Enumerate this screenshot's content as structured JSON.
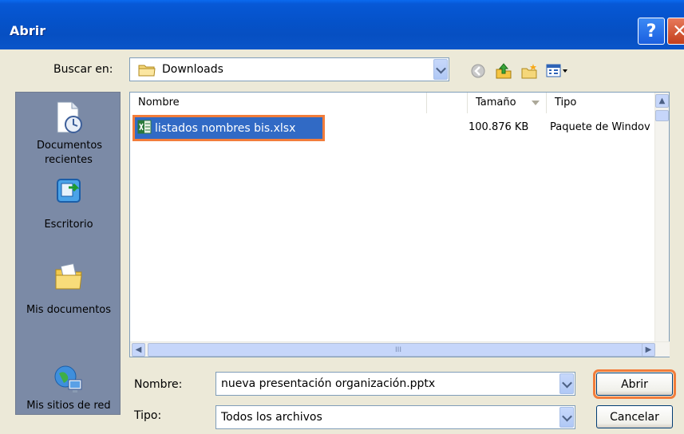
{
  "window": {
    "title": "Abrir",
    "help_label": "?",
    "close_label": "✕"
  },
  "location": {
    "label": "Buscar en:",
    "value": "Downloads"
  },
  "toolbar": {
    "icons": [
      "back-icon",
      "up-folder-icon",
      "new-folder-icon",
      "views-menu-icon"
    ]
  },
  "places": [
    {
      "label": "Documentos recientes",
      "icon": "recent-documents-icon"
    },
    {
      "label": "Escritorio",
      "icon": "desktop-icon"
    },
    {
      "label": "Mis documentos",
      "icon": "my-documents-icon"
    },
    {
      "label": "Mis sitios de red",
      "icon": "network-places-icon"
    }
  ],
  "file_list": {
    "columns": [
      "Nombre",
      "Tamaño",
      "Tipo"
    ],
    "rows": [
      {
        "name": "listados nombres bis.xlsx",
        "size": "100.876 KB",
        "type": "Paquete de Windov",
        "selected": true
      }
    ],
    "scroll_grip": "III"
  },
  "filename": {
    "label": "Nombre:",
    "value": "nueva presentación organización.pptx"
  },
  "filetype": {
    "label": "Tipo:",
    "value": "Todos los archivos"
  },
  "buttons": {
    "open": "Abrir",
    "cancel": "Cancelar"
  },
  "colors": {
    "title_bar": "#0552c9",
    "selection": "#316ac5",
    "highlight_outline": "#f27d3b",
    "places_bar": "#7b8aa6"
  }
}
